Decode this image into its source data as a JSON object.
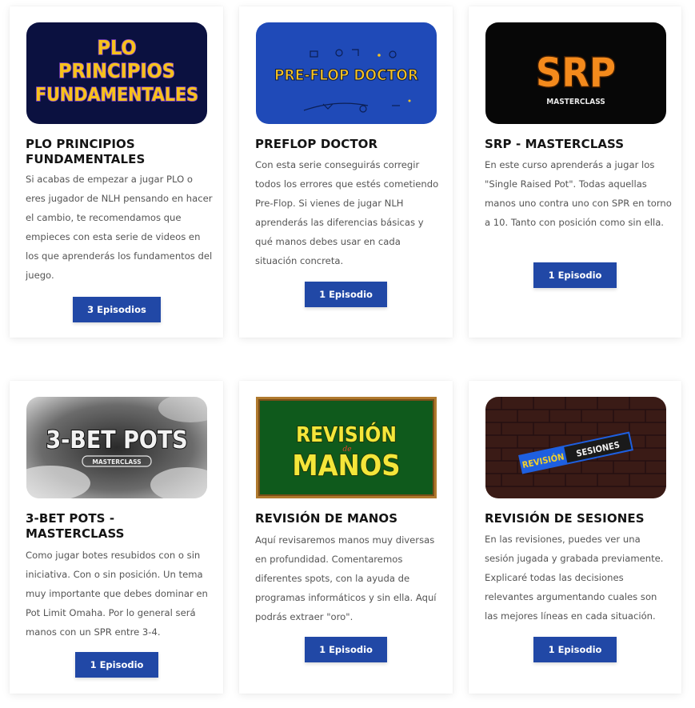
{
  "courses": [
    {
      "title": "PLO PRINCIPIOS FUNDAMENTALES",
      "description": "Si acabas de empezar a jugar PLO o eres jugador de NLH pensando en hacer el cambio, te recomendamos que empieces con esta serie de videos en los que aprenderás los fundamentos del juego.",
      "button": "3 Episodios",
      "image_text": [
        "PLO",
        "PRINCIPIOS",
        "FUNDAMENTALES"
      ]
    },
    {
      "title": "PREFLOP DOCTOR",
      "description": "Con esta serie conseguirás corregir todos los errores que estés cometiendo Pre-Flop. Si vienes de jugar NLH aprenderás las diferencias básicas y qué manos debes usar en cada situación concreta.",
      "button": "1 Episodio",
      "image_text": [
        "PRE-FLOP DOCTOR"
      ]
    },
    {
      "title": "SRP - MASTERCLASS",
      "description": "En este curso aprenderás a jugar los \"Single Raised Pot\". Todas aquellas manos uno contra uno con SPR en torno a 10. Tanto con posición como sin ella.",
      "button": "1 Episodio",
      "image_text": [
        "SRP",
        "MASTERCLASS"
      ]
    },
    {
      "title": "3-BET POTS - MASTERCLASS",
      "description": "Como jugar botes resubidos con o sin iniciativa. Con o sin posición. Un tema muy importante que debes dominar en Pot Limit Omaha. Por lo general será manos con un SPR entre 3-4.",
      "button": "1 Episodio",
      "image_text": [
        "3-BET POTS",
        "MASTERCLASS"
      ]
    },
    {
      "title": "REVISIÓN DE MANOS",
      "description": "Aquí revisaremos manos muy diversas en profundidad. Comentaremos diferentes spots, con la ayuda de programas informáticos y sin ella. Aquí podrás extraer \"oro\".",
      "button": "1 Episodio",
      "image_text": [
        "REVISIÓN",
        "de",
        "MANOS"
      ]
    },
    {
      "title": "REVISIÓN DE SESIONES",
      "description": "En las revisiones, puedes ver una sesión jugada y grabada previamente. Explicaré todas las decisiones relevantes argumentando cuales son las mejores líneas en cada situación.",
      "button": "1 Episodio",
      "image_text": [
        "REVISIÓN",
        "SESIONES"
      ]
    }
  ],
  "colors": {
    "button_bg": "#2148a6",
    "button_text": "#ffffff",
    "title": "#141414",
    "body_text": "#555555",
    "card_bg": "#ffffff"
  }
}
